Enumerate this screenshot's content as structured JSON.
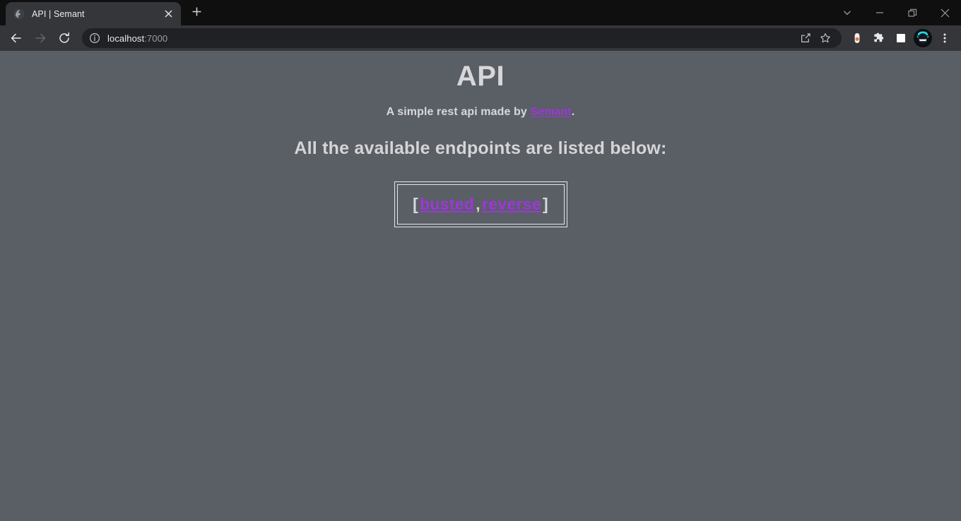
{
  "browser": {
    "tab": {
      "title": "API | Semant",
      "favicon_icon": "globe-icon",
      "close_icon": "close-icon"
    },
    "new_tab_icon": "plus-icon",
    "window_controls": {
      "tab_search_icon": "chevron-down-icon",
      "minimize_icon": "minimize-icon",
      "maximize_icon": "restore-icon",
      "close_icon": "close-icon"
    },
    "toolbar": {
      "back_icon": "back-arrow-icon",
      "forward_icon": "forward-arrow-icon",
      "reload_icon": "reload-icon",
      "site_info_icon": "info-circle-icon",
      "url_host": "localhost",
      "url_port": ":7000",
      "url_full": "localhost:7000",
      "share_icon": "share-icon",
      "bookmark_icon": "star-icon",
      "extension_pill_icon": "extension-toggle-icon",
      "extensions_icon": "puzzle-piece-icon",
      "side_panel_icon": "side-panel-icon",
      "profile_icon": "avatar-icon",
      "menu_icon": "three-dot-menu-icon"
    }
  },
  "page": {
    "title": "API",
    "subtitle": {
      "prefix": "A simple rest api made by ",
      "link_text": "Semant",
      "suffix": "."
    },
    "section_heading": "All the available endpoints are listed below:",
    "endpoints": {
      "open_bracket": "[",
      "separator": ",",
      "close_bracket": "]",
      "items": [
        {
          "label": "busted"
        },
        {
          "label": "reverse"
        }
      ]
    }
  },
  "colors": {
    "page_background": "#1b1d21",
    "pattern": "#5a5e65",
    "heading_text": "#d7d7d9",
    "link_purple": "#9e36dd",
    "box_border": "#e6e6e8",
    "chrome_toolbar": "#35363a",
    "chrome_tabstrip": "#0f0f10"
  }
}
